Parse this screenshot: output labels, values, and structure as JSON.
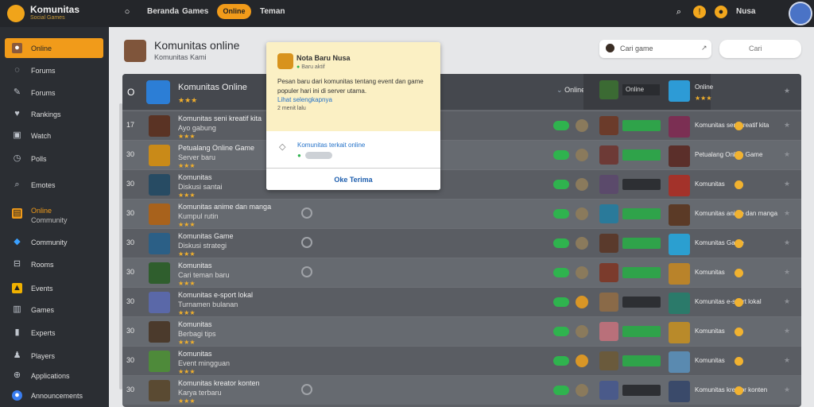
{
  "app": {
    "title": "Komunitas",
    "subtitle": "Social Games"
  },
  "topnav": {
    "items": [
      "Beranda",
      "Games",
      "Online",
      "Teman"
    ]
  },
  "sidebar": {
    "items": [
      {
        "label": "Online",
        "icon": "user-icon"
      },
      {
        "label": "Forums",
        "icon": "chat-icon"
      },
      {
        "label": "Forums",
        "icon": "pen-icon"
      },
      {
        "label": "Rankings",
        "icon": "heart-icon"
      },
      {
        "label": "Watch",
        "icon": "tv-icon"
      },
      {
        "label": "Polls",
        "icon": "clock-icon"
      },
      {
        "label": "Emotes",
        "icon": "search-icon"
      },
      {
        "label": "Online",
        "icon": "calendar-icon"
      },
      {
        "label": "Community",
        "icon": "group-icon"
      },
      {
        "label": "Rooms",
        "icon": "room-icon"
      },
      {
        "label": "Events",
        "icon": "bell-icon"
      },
      {
        "label": "Games",
        "icon": "games-icon"
      },
      {
        "label": "Experts",
        "icon": "star-icon"
      },
      {
        "label": "Players",
        "icon": "player-icon"
      },
      {
        "label": "Applications",
        "icon": "apps-icon"
      },
      {
        "label": "Announcements",
        "icon": "megaphone-icon"
      }
    ]
  },
  "main": {
    "title": "Komunitas online",
    "subtitle": "Komunitas Kami"
  },
  "search": {
    "placeholder": "Cari game",
    "button": "Cari"
  },
  "table": {
    "header": {
      "title": "Komunitas Online",
      "stars": "★★★",
      "label": "Online",
      "count_label": "Online"
    },
    "rows": [
      {
        "num": "17",
        "title": "Komunitas seni kreatif kita",
        "sub": "Ayo gabung",
        "stars": "★★★"
      },
      {
        "num": "30",
        "title": "Petualang Online Game",
        "sub": "Server baru",
        "stars": "★★★"
      },
      {
        "num": "30",
        "title": "Komunitas",
        "sub": "Diskusi santai",
        "stars": "★★★"
      },
      {
        "num": "30",
        "title": "Komunitas anime dan manga",
        "sub": "Kumpul rutin",
        "stars": "★★★"
      },
      {
        "num": "30",
        "title": "Komunitas Game",
        "sub": "Diskusi strategi",
        "stars": "★★★"
      },
      {
        "num": "30",
        "title": "Komunitas",
        "sub": "Cari teman baru",
        "stars": "★★★"
      },
      {
        "num": "30",
        "title": "Komunitas e-sport lokal",
        "sub": "Turnamen bulanan",
        "stars": "★★★"
      },
      {
        "num": "30",
        "title": "Komunitas",
        "sub": "Berbagi tips",
        "stars": "★★★"
      },
      {
        "num": "30",
        "title": "Komunitas",
        "sub": "Event mingguan",
        "stars": "★★★"
      },
      {
        "num": "30",
        "title": "Komunitas kreator konten",
        "sub": "Karya terbaru",
        "stars": "★★★"
      }
    ]
  },
  "popup": {
    "name": "Nota Baru Nusa",
    "status": "Baru aktif",
    "body": "Pesan baru dari komunitas tentang event dan game populer hari ini di server utama.",
    "link": "Lihat selengkapnya",
    "meta": "2 menit lalu",
    "link2": "Komunitas terkait online",
    "button": "Oke Terima"
  }
}
